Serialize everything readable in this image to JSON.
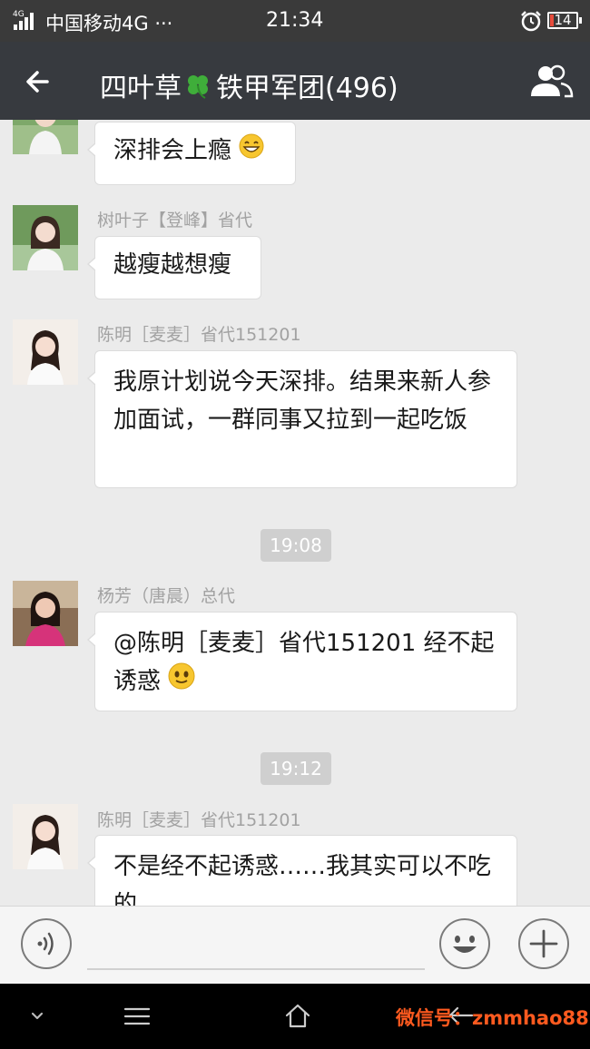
{
  "status_bar": {
    "network": "4G",
    "carrier": "中国移动4G",
    "dots": "···",
    "time": "21:34",
    "battery": "14",
    "battery_level": 0.14
  },
  "header": {
    "title_part1": "四叶草",
    "title_part2": "铁甲军团(496)"
  },
  "chat": {
    "messages": [
      {
        "text": "深排会上瘾"
      },
      {
        "sender": "树叶子【登峰】省代",
        "text": "越瘦越想瘦"
      },
      {
        "sender": "陈明［麦麦］省代151201",
        "text": "我原计划说今天深排。结果来新人参加面试，一群同事又拉到一起吃饭"
      },
      {
        "sender": "杨芳（唐晨）总代",
        "text": "@陈明［麦麦］省代151201 经不起诱惑"
      },
      {
        "sender": "陈明［麦麦］省代151201",
        "text": "不是经不起诱惑……我其实可以不吃的"
      }
    ],
    "timestamps": [
      "19:08",
      "19:12"
    ]
  },
  "watermark": "微信号：zmmhao88",
  "colors": {
    "title_bar": "#373a3f",
    "chat_bg": "#ebebeb",
    "watermark": "#ff5a1f",
    "battery_low": "#e74c3c"
  }
}
